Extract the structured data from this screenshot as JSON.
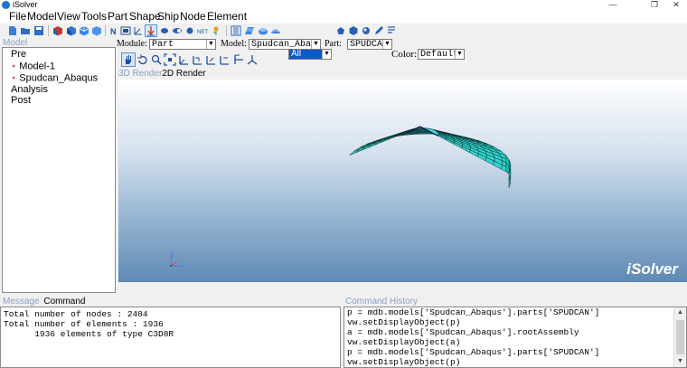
{
  "window": {
    "title": "iSolver",
    "min": "—",
    "max": "❐",
    "close": "✕"
  },
  "menu": [
    "File",
    "Model",
    "View",
    "Tools",
    "Part",
    "Shape",
    "Ship",
    "Node",
    "Element"
  ],
  "toolbar": {
    "filter_value": "All",
    "color_label": "Color:",
    "color_value": "Default",
    "dropdown_arrow": "▼"
  },
  "module_row": {
    "module_label": "Module:",
    "module_value": "Part",
    "model_label": "Model:",
    "model_value": "Spudcan_Abaqus",
    "part_label": "Part:",
    "part_value": "SPUDCAN"
  },
  "left_panel": {
    "title": "Model",
    "tree": [
      "Pre",
      "Model-1",
      "Spudcan_Abaqus",
      "Analysis",
      "Post"
    ]
  },
  "render_tabs": {
    "tab_3d": "3D Render",
    "tab_2d": "2D Render"
  },
  "viewport": {
    "brand": "iSolver"
  },
  "message_panel": {
    "tab_message": "Message",
    "tab_command": "Command",
    "lines": [
      "Total number of nodes : 2484",
      "Total number of elements : 1936",
      "      1936 elements of type C3D8R"
    ]
  },
  "history_panel": {
    "title": "Command History",
    "lines": [
      "p = mdb.models['Spudcan_Abaqus'].parts['SPUDCAN']",
      "vw.setDisplayObject(p)",
      "a = mdb.models['Spudcan_Abaqus'].rootAssembly",
      "vw.setDisplayObject(a)",
      "p = mdb.models['Spudcan_Abaqus'].parts['SPUDCAN']",
      "vw.setDisplayObject(p)"
    ]
  },
  "colors": {
    "mesh_fill": "#2fd6cf",
    "mesh_line": "#0a2a2a",
    "accent_blue": "#0a58c9",
    "disabled_text": "#8aa0c8"
  }
}
